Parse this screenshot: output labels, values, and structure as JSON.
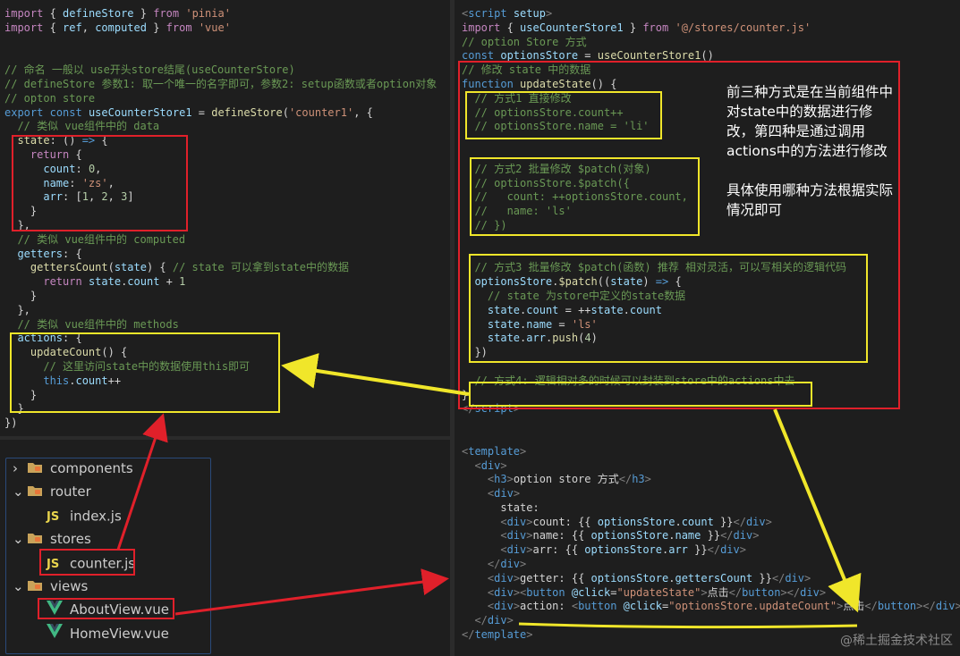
{
  "left_code": [
    [
      [
        "kw2",
        "import"
      ],
      [
        "punc",
        " { "
      ],
      [
        "var",
        "defineStore"
      ],
      [
        "punc",
        " } "
      ],
      [
        "kw2",
        "from"
      ],
      [
        "punc",
        " "
      ],
      [
        "str",
        "'pinia'"
      ]
    ],
    [
      [
        "kw2",
        "import"
      ],
      [
        "punc",
        " { "
      ],
      [
        "var",
        "ref"
      ],
      [
        "punc",
        ", "
      ],
      [
        "var",
        "computed"
      ],
      [
        "punc",
        " } "
      ],
      [
        "kw2",
        "from"
      ],
      [
        "punc",
        " "
      ],
      [
        "str",
        "'vue'"
      ]
    ],
    [],
    [],
    [
      [
        "cmt",
        "// 命名 一般以 use开头store结尾(useCounterStore)"
      ]
    ],
    [
      [
        "cmt",
        "// defineStore 参数1: 取一个唯一的名字即可，参数2: setup函数或者option对象"
      ]
    ],
    [
      [
        "cmt",
        "// opton store"
      ]
    ],
    [
      [
        "kw",
        "export"
      ],
      [
        "punc",
        " "
      ],
      [
        "kw",
        "const"
      ],
      [
        "punc",
        " "
      ],
      [
        "var",
        "useCounterStore1"
      ],
      [
        "punc",
        " = "
      ],
      [
        "fn",
        "defineStore"
      ],
      [
        "punc",
        "("
      ],
      [
        "str",
        "'counter1'"
      ],
      [
        "punc",
        ", {"
      ]
    ],
    [
      [
        "cmt",
        "  // 类似 vue组件中的 data"
      ]
    ],
    [
      [
        "fn",
        "  state"
      ],
      [
        "punc",
        ": () "
      ],
      [
        "kw",
        "=>"
      ],
      [
        "punc",
        " {"
      ]
    ],
    [
      [
        "kw2",
        "    return"
      ],
      [
        "punc",
        " {"
      ]
    ],
    [
      [
        "var",
        "      count"
      ],
      [
        "punc",
        ": "
      ],
      [
        "num",
        "0"
      ],
      [
        "punc",
        ","
      ]
    ],
    [
      [
        "var",
        "      name"
      ],
      [
        "punc",
        ": "
      ],
      [
        "str",
        "'zs'"
      ],
      [
        "punc",
        ","
      ]
    ],
    [
      [
        "var",
        "      arr"
      ],
      [
        "punc",
        ": ["
      ],
      [
        "num",
        "1"
      ],
      [
        "punc",
        ", "
      ],
      [
        "num",
        "2"
      ],
      [
        "punc",
        ", "
      ],
      [
        "num",
        "3"
      ],
      [
        "punc",
        "]"
      ]
    ],
    [
      [
        "punc",
        "    }"
      ]
    ],
    [
      [
        "punc",
        "  },"
      ]
    ],
    [
      [
        "cmt",
        "  // 类似 vue组件中的 computed"
      ]
    ],
    [
      [
        "var",
        "  getters"
      ],
      [
        "punc",
        ": {"
      ]
    ],
    [
      [
        "fn",
        "    gettersCount"
      ],
      [
        "punc",
        "("
      ],
      [
        "var",
        "state"
      ],
      [
        "punc",
        ") { "
      ],
      [
        "cmt",
        "// state 可以拿到state中的数据"
      ]
    ],
    [
      [
        "kw2",
        "      return"
      ],
      [
        "punc",
        " "
      ],
      [
        "var",
        "state"
      ],
      [
        "punc",
        "."
      ],
      [
        "var",
        "count"
      ],
      [
        "punc",
        " + "
      ],
      [
        "num",
        "1"
      ]
    ],
    [
      [
        "punc",
        "    }"
      ]
    ],
    [
      [
        "punc",
        "  },"
      ]
    ],
    [
      [
        "cmt",
        "  // 类似 vue组件中的 methods"
      ]
    ],
    [
      [
        "var",
        "  actions"
      ],
      [
        "punc",
        ": {"
      ]
    ],
    [
      [
        "fn",
        "    updateCount"
      ],
      [
        "punc",
        "() {"
      ]
    ],
    [
      [
        "cmt",
        "      // 这里访问state中的数据使用this即可"
      ]
    ],
    [
      [
        "kw",
        "      this"
      ],
      [
        "punc",
        "."
      ],
      [
        "var",
        "count"
      ],
      [
        "punc",
        "++"
      ]
    ],
    [
      [
        "punc",
        "    }"
      ]
    ],
    [
      [
        "punc",
        "  }"
      ]
    ],
    [
      [
        "punc",
        "})"
      ]
    ]
  ],
  "right_code": [
    [
      [
        "tag",
        "<"
      ],
      [
        "tagn",
        "script"
      ],
      [
        "punc",
        " "
      ],
      [
        "attr",
        "setup"
      ],
      [
        "tag",
        ">"
      ]
    ],
    [
      [
        "kw2",
        "import"
      ],
      [
        "punc",
        " { "
      ],
      [
        "var",
        "useCounterStore1"
      ],
      [
        "punc",
        " } "
      ],
      [
        "kw2",
        "from"
      ],
      [
        "punc",
        " "
      ],
      [
        "str",
        "'@/stores/counter.js'"
      ]
    ],
    [
      [
        "cmt",
        "// option Store 方式"
      ]
    ],
    [
      [
        "kw",
        "const"
      ],
      [
        "punc",
        " "
      ],
      [
        "var",
        "optionsStore"
      ],
      [
        "punc",
        " = "
      ],
      [
        "fn",
        "useCounterStore1"
      ],
      [
        "punc",
        "()"
      ]
    ],
    [
      [
        "cmt",
        "// 修改 state 中的数据"
      ]
    ],
    [
      [
        "kw",
        "function"
      ],
      [
        "punc",
        " "
      ],
      [
        "fn",
        "updateState"
      ],
      [
        "punc",
        "() {"
      ]
    ],
    [
      [
        "cmt",
        "  // 方式1 直接修改"
      ]
    ],
    [
      [
        "cmt",
        "  // optionsStore.count++"
      ]
    ],
    [
      [
        "cmt",
        "  // optionsStore.name = 'li'"
      ]
    ],
    [],
    [],
    [
      [
        "cmt",
        "  // 方式2 批量修改 $patch(对象)"
      ]
    ],
    [
      [
        "cmt",
        "  // optionsStore.$patch({"
      ]
    ],
    [
      [
        "cmt",
        "  //   count: ++optionsStore.count,"
      ]
    ],
    [
      [
        "cmt",
        "  //   name: 'ls'"
      ]
    ],
    [
      [
        "cmt",
        "  // })"
      ]
    ],
    [],
    [],
    [
      [
        "cmt",
        "  // 方式3 批量修改 $patch(函数) 推荐 相对灵活，可以写相关的逻辑代码"
      ]
    ],
    [
      [
        "var",
        "  optionsStore"
      ],
      [
        "punc",
        "."
      ],
      [
        "fn",
        "$patch"
      ],
      [
        "punc",
        "(("
      ],
      [
        "var",
        "state"
      ],
      [
        "punc",
        ") "
      ],
      [
        "kw",
        "=>"
      ],
      [
        "punc",
        " {"
      ]
    ],
    [
      [
        "cmt",
        "    // state 为store中定义的state数据"
      ]
    ],
    [
      [
        "var",
        "    state"
      ],
      [
        "punc",
        "."
      ],
      [
        "var",
        "count"
      ],
      [
        "punc",
        " = ++"
      ],
      [
        "var",
        "state"
      ],
      [
        "punc",
        "."
      ],
      [
        "var",
        "count"
      ]
    ],
    [
      [
        "var",
        "    state"
      ],
      [
        "punc",
        "."
      ],
      [
        "var",
        "name"
      ],
      [
        "punc",
        " = "
      ],
      [
        "str",
        "'ls'"
      ]
    ],
    [
      [
        "var",
        "    state"
      ],
      [
        "punc",
        "."
      ],
      [
        "var",
        "arr"
      ],
      [
        "punc",
        "."
      ],
      [
        "fn",
        "push"
      ],
      [
        "punc",
        "("
      ],
      [
        "num",
        "4"
      ],
      [
        "punc",
        ")"
      ]
    ],
    [
      [
        "punc",
        "  })"
      ]
    ],
    [],
    [
      [
        "cmt",
        "  // 方式4: 逻辑相对多的时候可以封装到store中的actions中去"
      ]
    ],
    [
      [
        "punc",
        "}"
      ]
    ],
    [
      [
        "tag",
        "</"
      ],
      [
        "tagn",
        "script"
      ],
      [
        "tag",
        ">"
      ]
    ],
    [],
    [],
    [
      [
        "tag",
        "<"
      ],
      [
        "tagn",
        "template"
      ],
      [
        "tag",
        ">"
      ]
    ],
    [
      [
        "tag",
        "  <"
      ],
      [
        "tagn",
        "div"
      ],
      [
        "tag",
        ">"
      ]
    ],
    [
      [
        "tag",
        "    <"
      ],
      [
        "tagn",
        "h3"
      ],
      [
        "tag",
        ">"
      ],
      [
        "punc",
        "option store 方式"
      ],
      [
        "tag",
        "</"
      ],
      [
        "tagn",
        "h3"
      ],
      [
        "tag",
        ">"
      ]
    ],
    [
      [
        "tag",
        "    <"
      ],
      [
        "tagn",
        "div"
      ],
      [
        "tag",
        ">"
      ]
    ],
    [
      [
        "punc",
        "      state:"
      ]
    ],
    [
      [
        "tag",
        "      <"
      ],
      [
        "tagn",
        "div"
      ],
      [
        "tag",
        ">"
      ],
      [
        "punc",
        "count: {{ "
      ],
      [
        "var",
        "optionsStore"
      ],
      [
        "punc",
        "."
      ],
      [
        "var",
        "count"
      ],
      [
        "punc",
        " }}"
      ],
      [
        "tag",
        "</"
      ],
      [
        "tagn",
        "div"
      ],
      [
        "tag",
        ">"
      ]
    ],
    [
      [
        "tag",
        "      <"
      ],
      [
        "tagn",
        "div"
      ],
      [
        "tag",
        ">"
      ],
      [
        "punc",
        "name: {{ "
      ],
      [
        "var",
        "optionsStore"
      ],
      [
        "punc",
        "."
      ],
      [
        "var",
        "name"
      ],
      [
        "punc",
        " }}"
      ],
      [
        "tag",
        "</"
      ],
      [
        "tagn",
        "div"
      ],
      [
        "tag",
        ">"
      ]
    ],
    [
      [
        "tag",
        "      <"
      ],
      [
        "tagn",
        "div"
      ],
      [
        "tag",
        ">"
      ],
      [
        "punc",
        "arr: {{ "
      ],
      [
        "var",
        "optionsStore"
      ],
      [
        "punc",
        "."
      ],
      [
        "var",
        "arr"
      ],
      [
        "punc",
        " }}"
      ],
      [
        "tag",
        "</"
      ],
      [
        "tagn",
        "div"
      ],
      [
        "tag",
        ">"
      ]
    ],
    [
      [
        "tag",
        "    </"
      ],
      [
        "tagn",
        "div"
      ],
      [
        "tag",
        ">"
      ]
    ],
    [
      [
        "tag",
        "    <"
      ],
      [
        "tagn",
        "div"
      ],
      [
        "tag",
        ">"
      ],
      [
        "punc",
        "getter: {{ "
      ],
      [
        "var",
        "optionsStore"
      ],
      [
        "punc",
        "."
      ],
      [
        "var",
        "gettersCount"
      ],
      [
        "punc",
        " }}"
      ],
      [
        "tag",
        "</"
      ],
      [
        "tagn",
        "div"
      ],
      [
        "tag",
        ">"
      ]
    ],
    [
      [
        "tag",
        "    <"
      ],
      [
        "tagn",
        "div"
      ],
      [
        "tag",
        "><"
      ],
      [
        "tagn",
        "button"
      ],
      [
        "punc",
        " "
      ],
      [
        "attr",
        "@click"
      ],
      [
        "punc",
        "="
      ],
      [
        "str",
        "\"updateState\""
      ],
      [
        "tag",
        ">"
      ],
      [
        "punc",
        "点击"
      ],
      [
        "tag",
        "</"
      ],
      [
        "tagn",
        "button"
      ],
      [
        "tag",
        "></"
      ],
      [
        "tagn",
        "div"
      ],
      [
        "tag",
        ">"
      ]
    ],
    [
      [
        "tag",
        "    <"
      ],
      [
        "tagn",
        "div"
      ],
      [
        "tag",
        ">"
      ],
      [
        "punc",
        "action: "
      ],
      [
        "tag",
        "<"
      ],
      [
        "tagn",
        "button"
      ],
      [
        "punc",
        " "
      ],
      [
        "attr",
        "@click"
      ],
      [
        "punc",
        "="
      ],
      [
        "str",
        "\"optionsStore.updateCount\""
      ],
      [
        "tag",
        ">"
      ],
      [
        "punc",
        "点击"
      ],
      [
        "tag",
        "</"
      ],
      [
        "tagn",
        "button"
      ],
      [
        "tag",
        "></"
      ],
      [
        "tagn",
        "div"
      ],
      [
        "tag",
        ">"
      ]
    ],
    [
      [
        "tag",
        "  </"
      ],
      [
        "tagn",
        "div"
      ],
      [
        "tag",
        ">"
      ]
    ],
    [
      [
        "tag",
        "</"
      ],
      [
        "tagn",
        "template"
      ],
      [
        "tag",
        ">"
      ]
    ]
  ],
  "file_tree": [
    {
      "label": "components",
      "icon": "folder-icon",
      "chevron": "›",
      "indent": 0
    },
    {
      "label": "router",
      "icon": "folder-icon",
      "chevron": "⌄",
      "indent": 0
    },
    {
      "label": "index.js",
      "icon": "js-file-icon",
      "chevron": "",
      "indent": 1
    },
    {
      "label": "stores",
      "icon": "folder-icon",
      "chevron": "⌄",
      "indent": 0
    },
    {
      "label": "counter.js",
      "icon": "js-file-icon",
      "chevron": "",
      "indent": 1
    },
    {
      "label": "views",
      "icon": "folder-icon",
      "chevron": "⌄",
      "indent": 0
    },
    {
      "label": "AboutView.vue",
      "icon": "vue-file-icon",
      "chevron": "",
      "indent": 1
    },
    {
      "label": "HomeView.vue",
      "icon": "vue-file-icon",
      "chevron": "",
      "indent": 1
    }
  ],
  "note": {
    "para1": "前三种方式是在当前组件中对state中的数据进行修改，第四种是通过调用actions中的方法进行修改",
    "para2": "具体使用哪种方法根据实际情况即可"
  },
  "watermark": "@稀土掘金技术社区",
  "colors": {
    "red": "#e0202a",
    "yellow": "#f0e62a"
  }
}
